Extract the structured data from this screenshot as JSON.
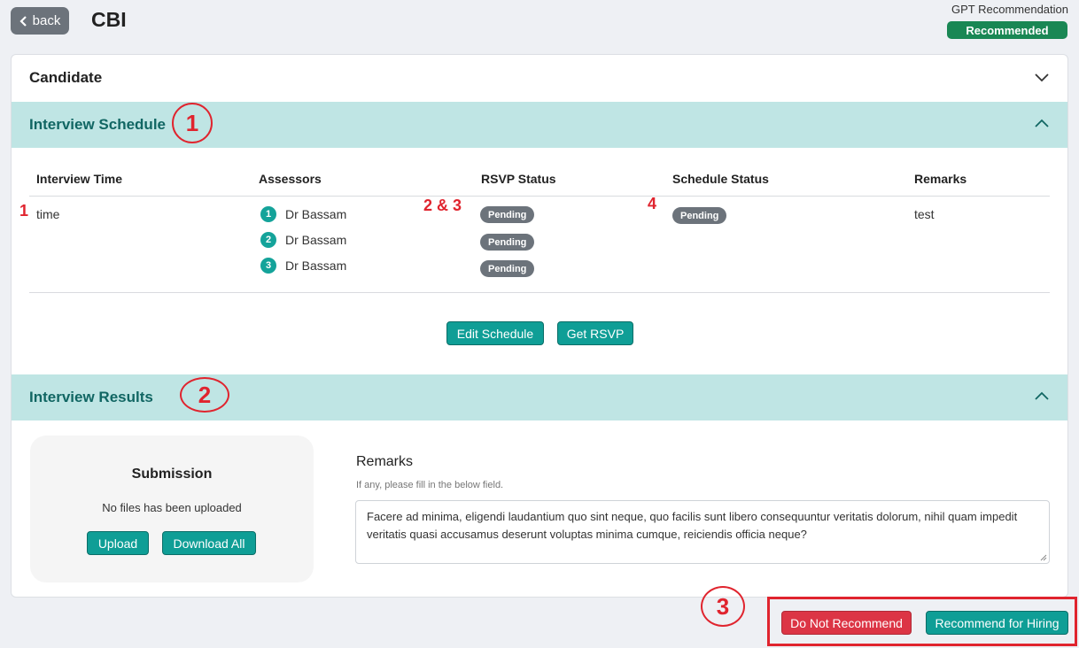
{
  "header": {
    "back_label": "back",
    "title": "CBI",
    "gpt_label": "GPT Recommendation",
    "gpt_badge": "Recommended"
  },
  "sections": {
    "candidate": "Candidate",
    "schedule": "Interview Schedule",
    "results": "Interview Results"
  },
  "schedule_table": {
    "columns": [
      "Interview Time",
      "Assessors",
      "RSVP Status",
      "Schedule Status",
      "Remarks"
    ],
    "row": {
      "time": "time",
      "assessors": [
        {
          "num": "1",
          "name": "Dr Bassam",
          "rsvp": "Pending"
        },
        {
          "num": "2",
          "name": "Dr Bassam",
          "rsvp": "Pending"
        },
        {
          "num": "3",
          "name": "Dr Bassam",
          "rsvp": "Pending"
        }
      ],
      "schedule_status": "Pending",
      "remarks": "test"
    },
    "buttons": {
      "edit": "Edit Schedule",
      "rsvp": "Get RSVP"
    }
  },
  "results": {
    "submission_title": "Submission",
    "submission_text": "No files has been uploaded",
    "upload_label": "Upload",
    "download_label": "Download All",
    "remarks_title": "Remarks",
    "remarks_hint": "If any, please fill in the below field.",
    "remarks_value": "Facere ad minima, eligendi laudantium quo sint neque, quo facilis sunt libero consequuntur veritatis dolorum, nihil quam impedit veritatis quasi accusamus deserunt voluptas minima cumque, reiciendis officia neque?"
  },
  "footer": {
    "reject_label": "Do Not Recommend",
    "accept_label": "Recommend for Hiring"
  },
  "annotations": {
    "row_marker": "1",
    "rsvp_marker": "2 & 3",
    "status_marker": "4",
    "circle_1": "1",
    "circle_2": "2",
    "circle_3": "3"
  },
  "colors": {
    "accent": "#0f9e96",
    "section_bg": "#bfe5e4",
    "success": "#198754",
    "danger": "#dc3545",
    "annotation": "#e0242e"
  }
}
